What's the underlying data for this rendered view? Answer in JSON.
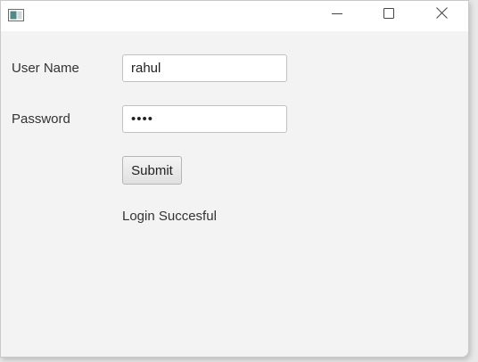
{
  "window": {
    "title": "",
    "controls": {
      "minimize_icon": "minimize-icon",
      "maximize_icon": "maximize-icon",
      "close_icon": "close-icon"
    }
  },
  "form": {
    "username_label": "User Name",
    "username_value": "rahul",
    "password_label": "Password",
    "password_value": "••••",
    "submit_label": "Submit",
    "status_text": "Login Succesful"
  },
  "colors": {
    "window_background": "#f3f3f3",
    "titlebar_background": "#ffffff",
    "text": "#333333",
    "field_border": "#c2c2c2"
  }
}
